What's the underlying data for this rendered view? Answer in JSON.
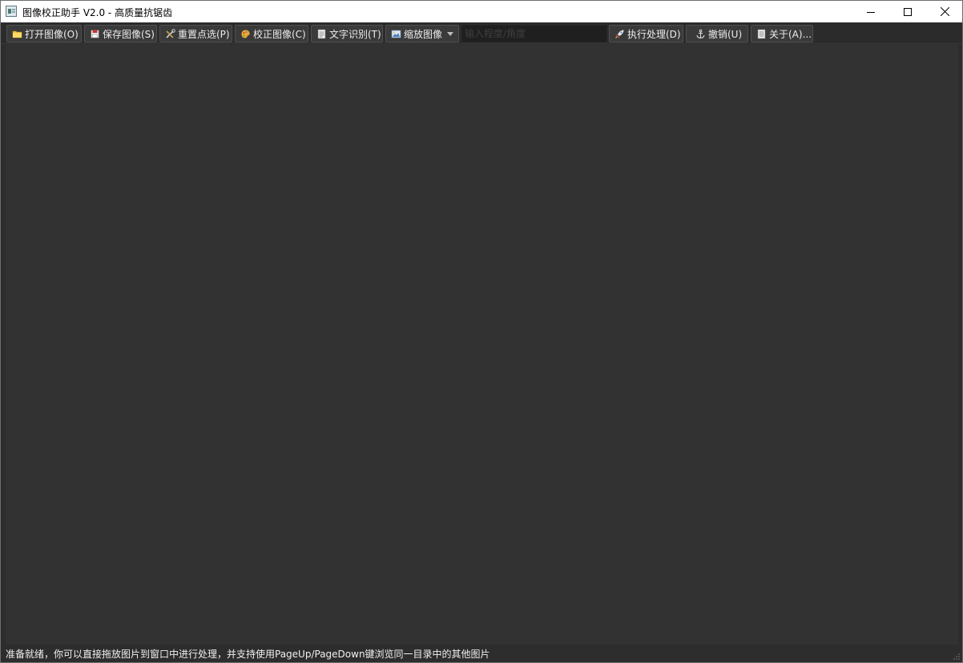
{
  "window": {
    "title": "图像校正助手 V2.0 - 高质量抗锯齿"
  },
  "toolbar": {
    "open": {
      "label": "打开图像(O)",
      "icon": "folder-icon"
    },
    "save": {
      "label": "保存图像(S)",
      "icon": "floppy-icon"
    },
    "reset": {
      "label": "重置点选(P)",
      "icon": "tools-icon"
    },
    "correct": {
      "label": "校正图像(C)",
      "icon": "palette-icon"
    },
    "ocr": {
      "label": "文字识别(T)",
      "icon": "document-icon"
    },
    "zoom": {
      "label": "缩放图像",
      "icon": "image-icon"
    },
    "input_placeholder": "输入程度/角度",
    "execute": {
      "label": "执行处理(D)",
      "icon": "rocket-icon"
    },
    "undo": {
      "label": "撤销(U)",
      "icon": "anchor-icon"
    },
    "about": {
      "label": "关于(A)...",
      "icon": "page-icon"
    }
  },
  "status": {
    "text": "准备就绪，你可以直接拖放图片到窗口中进行处理，并支持使用PageUp/PageDown键浏览同一目录中的其他图片"
  },
  "colors": {
    "canvas": "#323232",
    "toolbar_button": "#3a3a3a",
    "text": "#ececec"
  }
}
